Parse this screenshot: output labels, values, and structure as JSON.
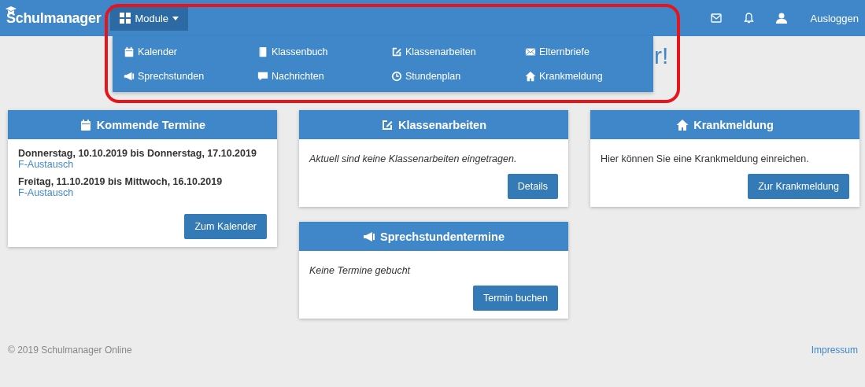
{
  "navbar": {
    "brand": "Schulmanager",
    "module_button": {
      "label": "Module",
      "expanded": true
    },
    "logout": "Ausloggen"
  },
  "module_menu": [
    {
      "label": "Kalender"
    },
    {
      "label": "Klassenbuch"
    },
    {
      "label": "Klassenarbeiten"
    },
    {
      "label": "Elternbriefe"
    },
    {
      "label": "Sprechstunden"
    },
    {
      "label": "Nachrichten"
    },
    {
      "label": "Stundenplan"
    },
    {
      "label": "Krankmeldung"
    }
  ],
  "greeting": "r!",
  "columns": [
    [
      {
        "title": "Kommende Termine",
        "kind": "events",
        "events": [
          {
            "date": "Donnerstag, 10.10.2019 bis Donnerstag, 17.10.2019",
            "title": "F-Austausch"
          },
          {
            "date": "Freitag, 11.10.2019 bis Mittwoch, 16.10.2019",
            "title": "F-Austausch"
          }
        ],
        "button": "Zum Kalender"
      }
    ],
    [
      {
        "title": "Klassenarbeiten",
        "kind": "notice",
        "text": "Aktuell sind keine Klassenarbeiten eingetragen.",
        "button": "Details"
      },
      {
        "title": "Sprechstundentermine",
        "kind": "notice",
        "text": "Keine Termine gebucht",
        "button": "Termin buchen"
      }
    ],
    [
      {
        "title": "Krankmeldung",
        "kind": "info",
        "text": "Hier können Sie eine Krankmeldung einreichen.",
        "button": "Zur Krankmeldung"
      }
    ]
  ],
  "footer": {
    "copyright": "© 2019 Schulmanager Online",
    "link": "Impressum"
  },
  "annotation": {
    "kind": "highlight"
  }
}
